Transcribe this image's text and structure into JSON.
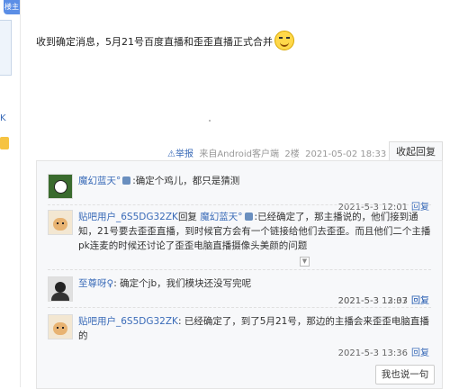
{
  "left": {
    "floor_badge": "楼主",
    "fragment_text": "K"
  },
  "post": {
    "text": "收到确定消息，5月21号百度直播和歪歪直播正式合并"
  },
  "meta": {
    "report": "举报",
    "source": "来自Android客户端",
    "floor": "2楼",
    "datetime": "2021-05-02 18:33",
    "collapse": "收起回复"
  },
  "replies": [
    {
      "user": "魔幻蓝天°",
      "text": ":确定个鸡儿，都只是猜测",
      "time": "2021-5-3 12:01",
      "reply": "回复"
    },
    {
      "user": "贴吧用户_6S5DG32ZK",
      "prefix": "回复",
      "target": "魔幻蓝天°",
      "text": ":已经确定了，那主播说的，他们接到通知，21号要去歪歪直播，到时候官方会有一个链接给他们去歪歪。而且他们二个主播pk连麦的时候还讨论了歪歪电脑直播摄像头美颜的问题",
      "time": "2021-5-3 12:07",
      "reply": "回复"
    },
    {
      "user": "至尊呀♀",
      "text": ": 确定个jb，我们模块还没写完呢",
      "time": "2021-5-3 13:33",
      "reply": "回复"
    },
    {
      "user": "贴吧用户_6S5DG32ZK",
      "text": ": 已经确定了，到了5月21号，那边的主播会来歪歪电脑直播的",
      "time": "2021-5-3 13:36",
      "reply": "回复"
    }
  ],
  "say_button": "我也说一句"
}
